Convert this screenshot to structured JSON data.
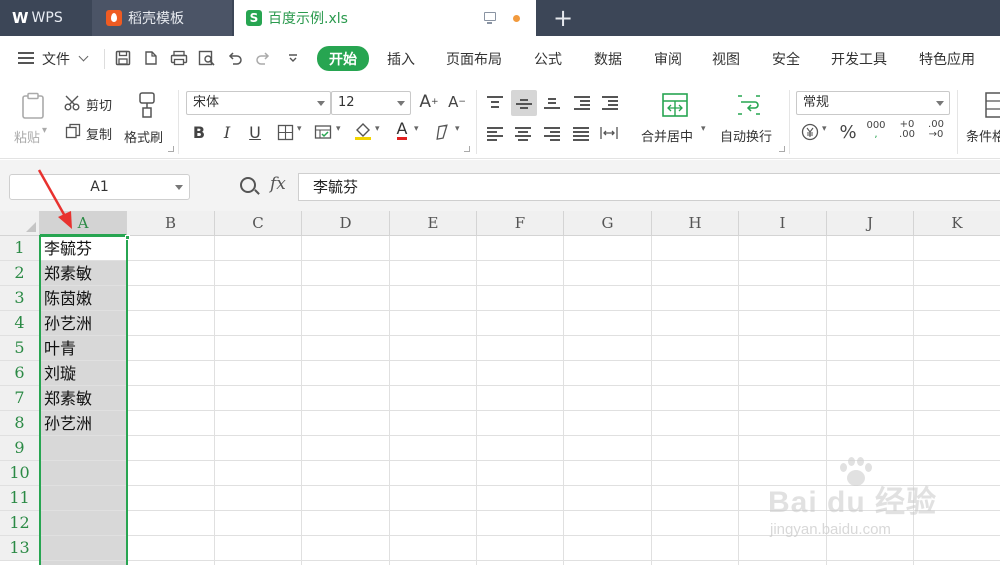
{
  "tabs": {
    "wps_label": "WPS",
    "template_label": "稻壳模板",
    "doc_label": "百度示例.xls"
  },
  "menu": {
    "file": "文件",
    "items": [
      "开始",
      "插入",
      "页面布局",
      "公式",
      "数据",
      "审阅",
      "视图",
      "安全",
      "开发工具",
      "特色应用"
    ],
    "active": "开始"
  },
  "ribbon": {
    "paste": "粘贴",
    "cut": "剪切",
    "copy": "复制",
    "format_painter": "格式刷",
    "font_name": "宋体",
    "font_size": "12",
    "bold": "B",
    "italic": "I",
    "underline": "U",
    "font_color": "A",
    "merge_center": "合并居中",
    "wrap_text": "自动换行",
    "number_format": "常规",
    "percent": "%",
    "thousands": "000",
    "inc_decimal": "+0 .00",
    "dec_decimal": ".00 →0",
    "conditional": "条件格"
  },
  "formula_bar": {
    "name_box": "A1",
    "fx": "fx",
    "content": "李毓芬"
  },
  "grid": {
    "columns": [
      "A",
      "B",
      "C",
      "D",
      "E",
      "F",
      "G",
      "H",
      "I",
      "J",
      "K"
    ],
    "rows": [
      "1",
      "2",
      "3",
      "4",
      "5",
      "6",
      "7",
      "8",
      "9",
      "10",
      "11",
      "12",
      "13"
    ],
    "selected_column": "A",
    "active_cell": "A1",
    "column_a": [
      "李毓芬",
      "郑素敏",
      "陈茵嫩",
      "孙艺洲",
      "叶青",
      "刘璇",
      "郑素敏",
      "孙艺洲"
    ]
  },
  "watermark": {
    "brand": "Bai du 经验",
    "url": "jingyan.baidu.com"
  },
  "colors": {
    "accent": "#27a551",
    "tabbar": "#3c4657",
    "annotation": "#e8322f"
  }
}
